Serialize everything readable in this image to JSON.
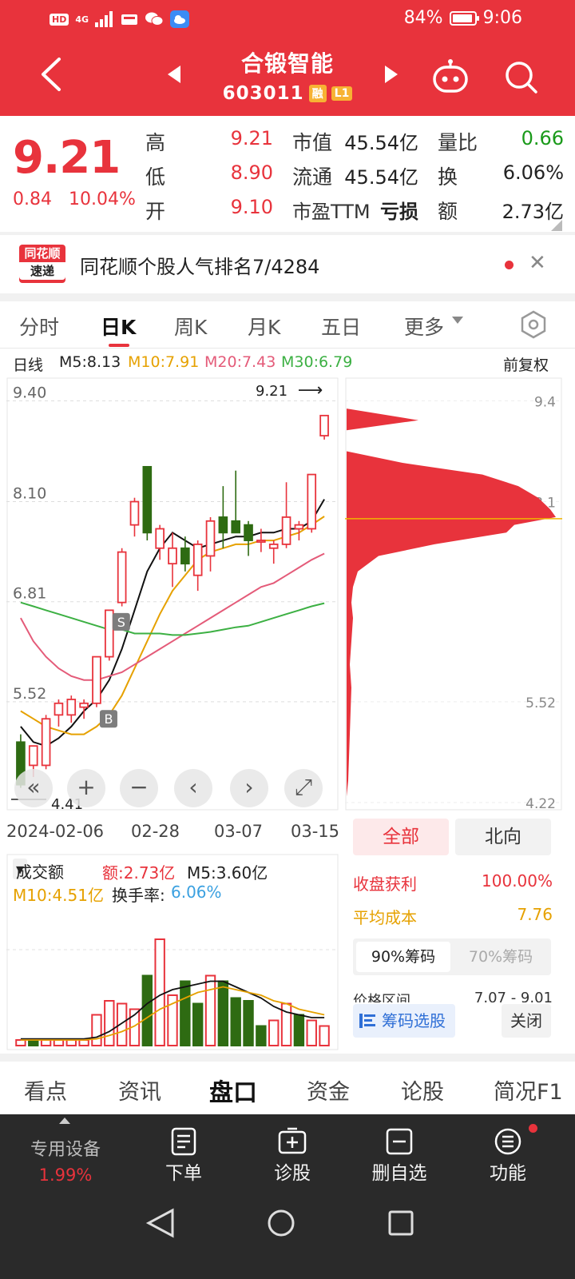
{
  "status_bar": {
    "left_badge": "HD",
    "network": "4G",
    "battery_pct": "84%",
    "time": "9:06"
  },
  "header": {
    "stock_name": "合锻智能",
    "stock_code": "603011",
    "tags": [
      "融",
      "L1"
    ]
  },
  "quote": {
    "price": "9.21",
    "change": "0.84",
    "change_pct": "10.04%",
    "fields": [
      {
        "label": "高",
        "value": "9.21"
      },
      {
        "label": "低",
        "value": "8.90"
      },
      {
        "label": "开",
        "value": "9.10"
      },
      {
        "label": "市值",
        "value": "45.54亿"
      },
      {
        "label": "流通",
        "value": "45.54亿"
      },
      {
        "label": "市盈TTM",
        "value": "亏损"
      },
      {
        "label": "量比",
        "value": "0.66"
      },
      {
        "label": "换",
        "value": "6.06%"
      },
      {
        "label": "额",
        "value": "2.73亿"
      }
    ]
  },
  "rank_banner": {
    "logo_top": "同花顺",
    "logo_bottom": "速递",
    "text": "同花顺个股人气排名7/4284"
  },
  "period_tabs": [
    "分时",
    "日K",
    "周K",
    "月K",
    "五日",
    "更多"
  ],
  "ma_legend": {
    "label": "日线",
    "items": [
      "M5:8.13",
      "M10:7.91",
      "M20:7.43",
      "M30:6.79"
    ],
    "colors": [
      "#222222",
      "#e6a100",
      "#e45b79",
      "#3cb043"
    ],
    "right": "前复权"
  },
  "kline": {
    "y_ticks": [
      "9.40",
      "8.10",
      "6.81",
      "5.52"
    ],
    "last_price_label": "9.21",
    "low_label": "4.41",
    "x_labels": [
      "2024-02-06",
      "02-28",
      "03-07",
      "03-15"
    ],
    "markers": [
      "S",
      "B"
    ],
    "buttons": [
      "«",
      "+",
      "−",
      "‹",
      "›",
      "⤢"
    ]
  },
  "chip": {
    "y_ticks": [
      "9.4",
      "8.1",
      "5.52",
      "4.22"
    ]
  },
  "chart_data": [
    {
      "type": "candlestick",
      "ylim": [
        4.22,
        9.6
      ],
      "candles": [
        {
          "o": 5.0,
          "h": 5.1,
          "l": 4.41,
          "c": 4.45
        },
        {
          "o": 4.7,
          "h": 4.95,
          "l": 4.55,
          "c": 4.95
        },
        {
          "o": 4.7,
          "h": 5.35,
          "l": 4.65,
          "c": 5.3
        },
        {
          "o": 5.35,
          "h": 5.55,
          "l": 5.2,
          "c": 5.5
        },
        {
          "o": 5.35,
          "h": 5.6,
          "l": 5.25,
          "c": 5.55
        },
        {
          "o": 5.45,
          "h": 5.55,
          "l": 5.3,
          "c": 5.5
        },
        {
          "o": 5.5,
          "h": 6.1,
          "l": 5.45,
          "c": 6.1
        },
        {
          "o": 6.1,
          "h": 6.7,
          "l": 6.05,
          "c": 6.7
        },
        {
          "o": 6.8,
          "h": 7.5,
          "l": 6.75,
          "c": 7.45
        },
        {
          "o": 7.8,
          "h": 8.15,
          "l": 7.65,
          "c": 8.1
        },
        {
          "o": 8.55,
          "h": 8.55,
          "l": 7.6,
          "c": 7.7
        },
        {
          "o": 7.5,
          "h": 7.8,
          "l": 7.35,
          "c": 7.75
        },
        {
          "o": 7.3,
          "h": 7.7,
          "l": 7.0,
          "c": 7.5
        },
        {
          "o": 7.5,
          "h": 7.65,
          "l": 7.2,
          "c": 7.3
        },
        {
          "o": 7.15,
          "h": 7.6,
          "l": 6.95,
          "c": 7.55
        },
        {
          "o": 7.4,
          "h": 7.9,
          "l": 7.2,
          "c": 7.85
        },
        {
          "o": 7.9,
          "h": 8.3,
          "l": 7.5,
          "c": 7.7
        },
        {
          "o": 7.85,
          "h": 8.5,
          "l": 7.7,
          "c": 7.7
        },
        {
          "o": 7.8,
          "h": 7.85,
          "l": 7.4,
          "c": 7.6
        },
        {
          "o": 7.6,
          "h": 7.75,
          "l": 7.45,
          "c": 7.6
        },
        {
          "o": 7.5,
          "h": 7.6,
          "l": 7.3,
          "c": 7.55
        },
        {
          "o": 7.55,
          "h": 8.35,
          "l": 7.5,
          "c": 7.9
        },
        {
          "o": 7.75,
          "h": 7.85,
          "l": 7.6,
          "c": 7.8
        },
        {
          "o": 7.75,
          "h": 8.45,
          "l": 7.7,
          "c": 8.45
        },
        {
          "o": 8.95,
          "h": 9.21,
          "l": 8.9,
          "c": 9.21
        }
      ],
      "ma": {
        "M5": [
          5.2,
          5.0,
          4.95,
          5.05,
          5.2,
          5.4,
          5.55,
          5.8,
          6.2,
          6.7,
          7.2,
          7.5,
          7.7,
          7.6,
          7.5,
          7.55,
          7.6,
          7.65,
          7.65,
          7.7,
          7.7,
          7.75,
          7.75,
          7.85,
          8.13
        ],
        "M10": [
          5.4,
          5.3,
          5.2,
          5.15,
          5.1,
          5.1,
          5.2,
          5.35,
          5.6,
          5.95,
          6.3,
          6.65,
          6.95,
          7.15,
          7.35,
          7.45,
          7.5,
          7.55,
          7.55,
          7.6,
          7.6,
          7.65,
          7.7,
          7.8,
          7.91
        ],
        "M20": [
          6.6,
          6.3,
          6.1,
          5.95,
          5.85,
          5.8,
          5.8,
          5.85,
          5.9,
          6.0,
          6.1,
          6.2,
          6.3,
          6.4,
          6.5,
          6.6,
          6.7,
          6.8,
          6.9,
          7.0,
          7.05,
          7.15,
          7.25,
          7.35,
          7.43
        ],
        "M30": [
          6.8,
          6.75,
          6.7,
          6.65,
          6.6,
          6.55,
          6.5,
          6.45,
          6.45,
          6.4,
          6.4,
          6.4,
          6.38,
          6.38,
          6.4,
          6.42,
          6.45,
          6.48,
          6.5,
          6.55,
          6.6,
          6.65,
          6.7,
          6.75,
          6.79
        ]
      }
    },
    {
      "type": "bar",
      "title": "成交额",
      "ylim": [
        0,
        3.0
      ],
      "values": [
        0.1,
        0.1,
        0.1,
        0.1,
        0.1,
        0.1,
        0.55,
        0.8,
        0.75,
        0.65,
        1.25,
        1.9,
        0.9,
        1.15,
        0.75,
        1.25,
        1.15,
        0.85,
        0.8,
        0.35,
        0.45,
        0.75,
        0.55,
        0.45,
        0.35
      ],
      "colors": [
        "red",
        "green",
        "red",
        "red",
        "red",
        "red",
        "red",
        "red",
        "red",
        "red",
        "green",
        "red",
        "red",
        "green",
        "green",
        "red",
        "green",
        "green",
        "green",
        "green",
        "red",
        "red",
        "green",
        "red",
        "red"
      ],
      "ma": {
        "M5": [
          0.12,
          0.12,
          0.12,
          0.12,
          0.12,
          0.12,
          0.15,
          0.25,
          0.4,
          0.55,
          0.75,
          0.9,
          1.0,
          1.05,
          1.1,
          1.15,
          1.15,
          1.05,
          0.95,
          0.85,
          0.7,
          0.6,
          0.55,
          0.5,
          0.5
        ],
        "M10": [
          0.1,
          0.1,
          0.1,
          0.1,
          0.1,
          0.1,
          0.12,
          0.18,
          0.25,
          0.35,
          0.5,
          0.65,
          0.75,
          0.85,
          0.95,
          1.0,
          1.05,
          1.0,
          0.95,
          0.9,
          0.8,
          0.75,
          0.65,
          0.6,
          0.55
        ]
      }
    }
  ],
  "volume": {
    "selector": "成交额",
    "amount": "额:2.73亿",
    "m5": "M5:3.60亿",
    "m10": "M10:4.51亿",
    "turnover_label": "换手率:",
    "turnover": "6.06%"
  },
  "chip_panel": {
    "buttons": [
      "全部",
      "北向"
    ],
    "profit_label": "收盘获利",
    "profit_value": "100.00%",
    "avg_label": "平均成本",
    "avg_value": "7.76",
    "pct_tabs": [
      "90%筹码",
      "70%筹码"
    ],
    "range_label": "价格区间",
    "range_value": "7.07 - 9.01",
    "select_label": "筹码选股",
    "close_label": "关闭"
  },
  "info_tabs": [
    "看点",
    "资讯",
    "盘口",
    "资金",
    "论股",
    "简况F1"
  ],
  "toolbar": {
    "device_label": "专用设备",
    "device_pct": "1.99%",
    "items": [
      "下单",
      "诊股",
      "删自选",
      "功能"
    ]
  }
}
